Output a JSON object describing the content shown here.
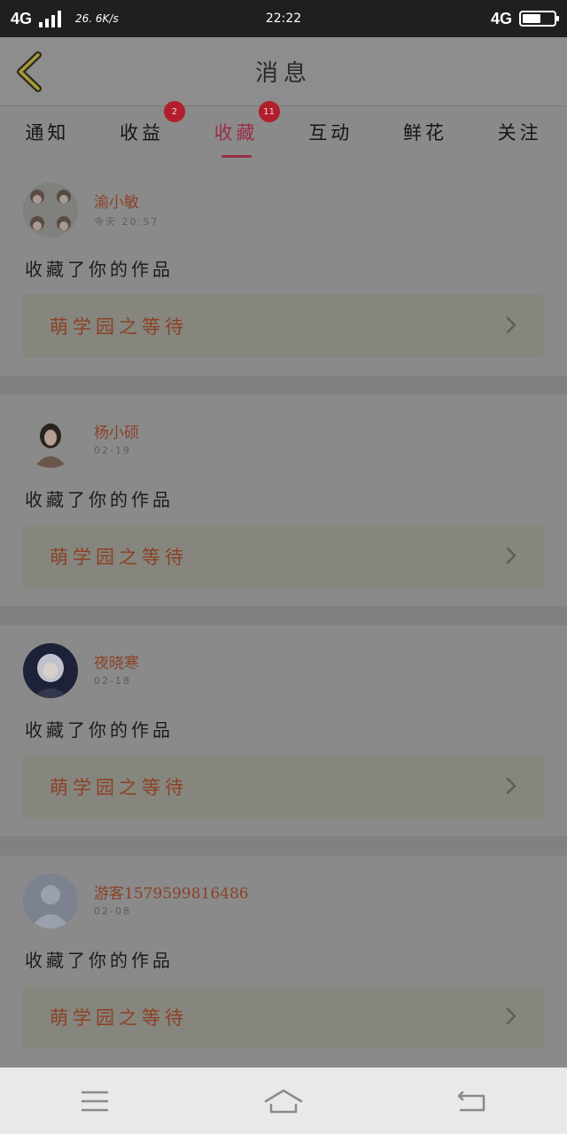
{
  "status_bar": {
    "network_left": "4G",
    "speed": "26. 6K/s",
    "time": "22:22",
    "network_right": "4G"
  },
  "header": {
    "title": "消息",
    "back_icon": "chevron-left-icon"
  },
  "tabs": [
    {
      "label": "通知",
      "badge": ""
    },
    {
      "label": "收益",
      "badge": "2"
    },
    {
      "label": "收藏",
      "badge": "11",
      "active": true
    },
    {
      "label": "互动",
      "badge": ""
    },
    {
      "label": "鲜花",
      "badge": ""
    },
    {
      "label": "关注",
      "badge": ""
    }
  ],
  "messages": [
    {
      "username": "渝小敏",
      "date": "今天 20:57",
      "action": "收藏了你的作品",
      "work_title": "萌学园之等待"
    },
    {
      "username": "杨小硕",
      "date": "02-19",
      "action": "收藏了你的作品",
      "work_title": "萌学园之等待"
    },
    {
      "username": "夜晓寒",
      "date": "02-18",
      "action": "收藏了你的作品",
      "work_title": "萌学园之等待"
    },
    {
      "username": "游客1579599816486",
      "date": "02-08",
      "action": "收藏了你的作品",
      "work_title": "萌学园之等待"
    }
  ],
  "nav_bar": {
    "menu_icon": "menu-icon",
    "home_icon": "home-icon",
    "back_icon": "return-icon"
  },
  "colors": {
    "accent": "#9a2f48",
    "badge": "#b31e2c",
    "name": "#8b4126"
  }
}
